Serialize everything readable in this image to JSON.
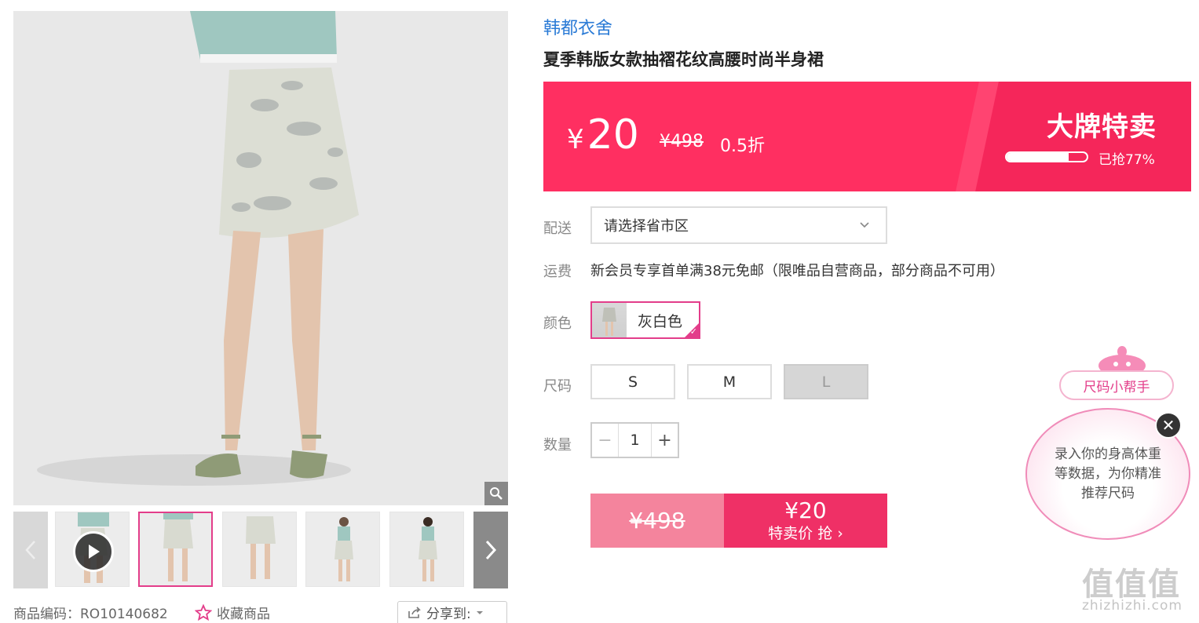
{
  "product": {
    "brand": "韩都衣舍",
    "title": "夏季韩版女款抽褶花纹高腰时尚半身裙",
    "code_label": "商品编码：",
    "code": "RO10140682",
    "favorite_label": "收藏商品",
    "share_label": "分享到:"
  },
  "price_banner": {
    "currency": "¥",
    "current_price": "20",
    "original_price": "¥498",
    "discount": "0.5折",
    "sale_label": "大牌特卖",
    "sold_text": "已抢77%",
    "sold_percent": 77,
    "background_color": "#ff2f61"
  },
  "options": {
    "delivery_label": "配送",
    "delivery_placeholder": "请选择省市区",
    "shipping_label": "运费",
    "shipping_text": "新会员专享首单满38元免邮（限唯品自营商品，部分商品不可用）",
    "color_label": "颜色",
    "color_value": "灰白色",
    "size_label": "尺码",
    "sizes": [
      {
        "label": "S",
        "available": true
      },
      {
        "label": "M",
        "available": true
      },
      {
        "label": "L",
        "available": false
      }
    ],
    "quantity_label": "数量",
    "quantity": "1"
  },
  "buy": {
    "original_price": "¥498",
    "price": "¥20",
    "action_label": "特卖价 抢 ›",
    "accent_color": "#ef3066"
  },
  "size_helper": {
    "title": "尺码小帮手",
    "message": "录入你的身高体重等数据，为你精准推荐尺码"
  },
  "watermark": {
    "main": "值值值",
    "sub": "zhizhizhi.com"
  },
  "icons": [
    "zoom-icon",
    "play-icon",
    "chevron-left-icon",
    "chevron-right-icon",
    "star-icon",
    "share-icon",
    "chevron-down-icon",
    "close-icon",
    "check-icon"
  ]
}
